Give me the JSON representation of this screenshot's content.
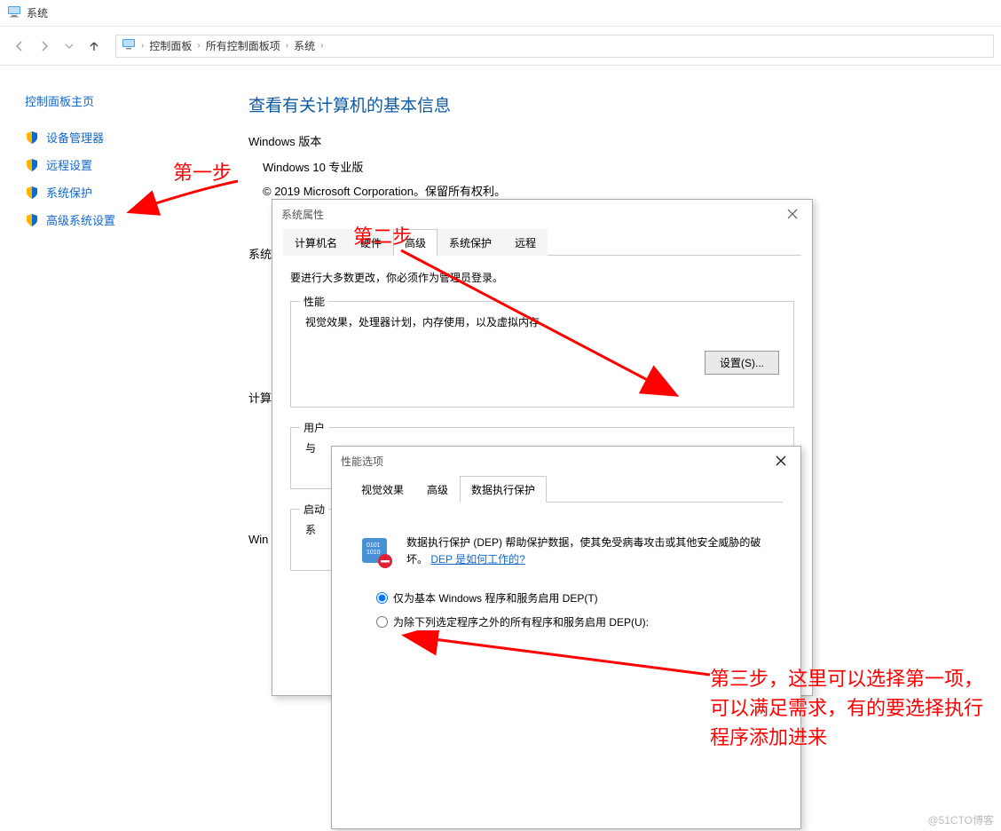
{
  "window": {
    "title": "系统"
  },
  "breadcrumb": {
    "items": [
      "控制面板",
      "所有控制面板项",
      "系统"
    ]
  },
  "sidebar": {
    "home": "控制面板主页",
    "items": [
      {
        "label": "设备管理器"
      },
      {
        "label": "远程设置"
      },
      {
        "label": "系统保护"
      },
      {
        "label": "高级系统设置"
      }
    ]
  },
  "content": {
    "heading": "查看有关计算机的基本信息",
    "section_win": "Windows 版本",
    "win_edition": "Windows 10 专业版",
    "copyright": "© 2019 Microsoft Corporation。保留所有权利。",
    "label_sys": "系统",
    "label_comp": "计算",
    "label_win": "Win",
    "label_start": "启动",
    "label_user": "用户",
    "label_and": "与",
    "label_sysset": "系"
  },
  "sysprops": {
    "title": "系统属性",
    "tabs": [
      "计算机名",
      "硬件",
      "高级",
      "系统保护",
      "远程"
    ],
    "active_tab": 2,
    "admin_note": "要进行大多数更改，你必须作为管理员登录。",
    "perf": {
      "legend": "性能",
      "desc": "视觉效果，处理器计划，内存使用，以及虚拟内存",
      "btn": "设置(S)..."
    },
    "userprof_legend": "用户"
  },
  "perfopts": {
    "title": "性能选项",
    "tabs": [
      "视觉效果",
      "高级",
      "数据执行保护"
    ],
    "active_tab": 2,
    "dep_desc": "数据执行保护 (DEP) 帮助保护数据，使其免受病毒攻击或其他安全威胁的破坏。",
    "dep_link": "DEP 是如何工作的?",
    "radio1": "仅为基本 Windows 程序和服务启用 DEP(T)",
    "radio2": "为除下列选定程序之外的所有程序和服务启用 DEP(U):"
  },
  "annotations": {
    "step1": "第一步",
    "step2": "第二步",
    "step3": "第三步，这里可以选择第一项，可以满足需求，有的要选择执行程序添加进来"
  },
  "watermark": "@51CTO博客"
}
